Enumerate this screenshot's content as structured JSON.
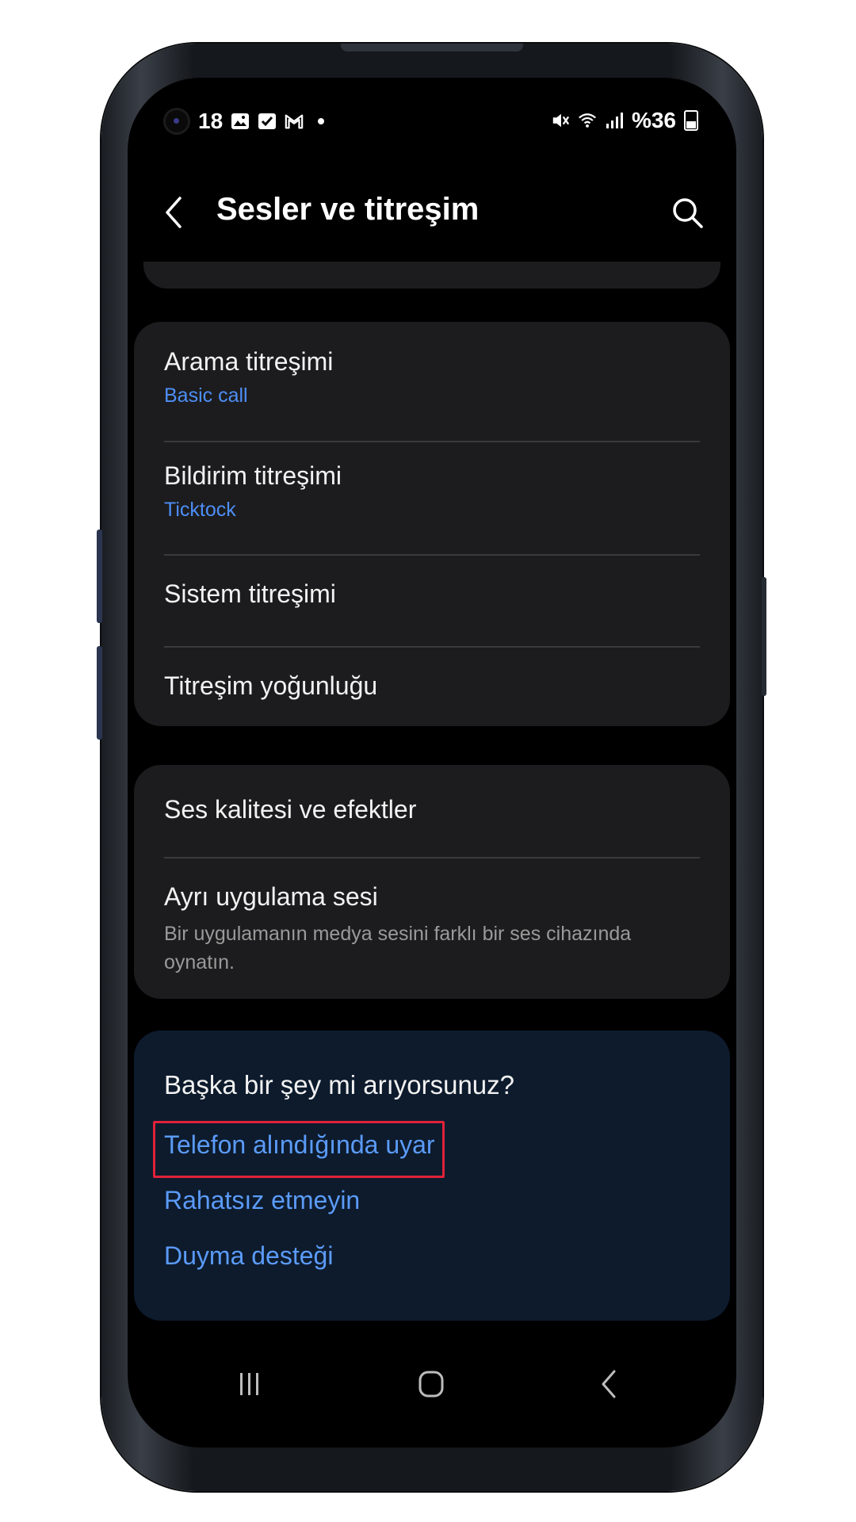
{
  "status_bar": {
    "time": "18",
    "battery_text": "%36",
    "left_icons": [
      "gallery-icon",
      "check-icon",
      "gmail-icon",
      "dot-icon"
    ],
    "right_icons": [
      "mute-vibrate-icon",
      "wifi-icon",
      "signal-icon",
      "battery-icon"
    ]
  },
  "app_bar": {
    "title": "Sesler ve titreşim",
    "back_icon": "chevron-left-icon",
    "search_icon": "search-icon"
  },
  "vibration_card": {
    "items": [
      {
        "title": "Arama titreşimi",
        "subtitle": "Basic call"
      },
      {
        "title": "Bildirim titreşimi",
        "subtitle": "Ticktock"
      },
      {
        "title": "Sistem titreşimi"
      },
      {
        "title": "Titreşim yoğunluğu"
      }
    ]
  },
  "sound_card": {
    "items": [
      {
        "title": "Ses kalitesi ve efektler"
      },
      {
        "title": "Ayrı uygulama sesi",
        "description": "Bir uygulamanın medya sesini farklı bir ses cihazında oynatın."
      }
    ]
  },
  "suggestions": {
    "title": "Başka bir şey mi arıyorsunuz?",
    "links": [
      "Telefon alındığında uyar",
      "Rahatsız etmeyin",
      "Duyma desteği"
    ]
  },
  "colors": {
    "accent_link": "#5b9bf8",
    "highlight_border": "#e0223a",
    "card_bg": "#1c1c1e",
    "suggest_bg": "#0d1b2d"
  },
  "nav_bar": {
    "buttons": [
      "recents-icon",
      "home-icon",
      "back-icon"
    ]
  }
}
